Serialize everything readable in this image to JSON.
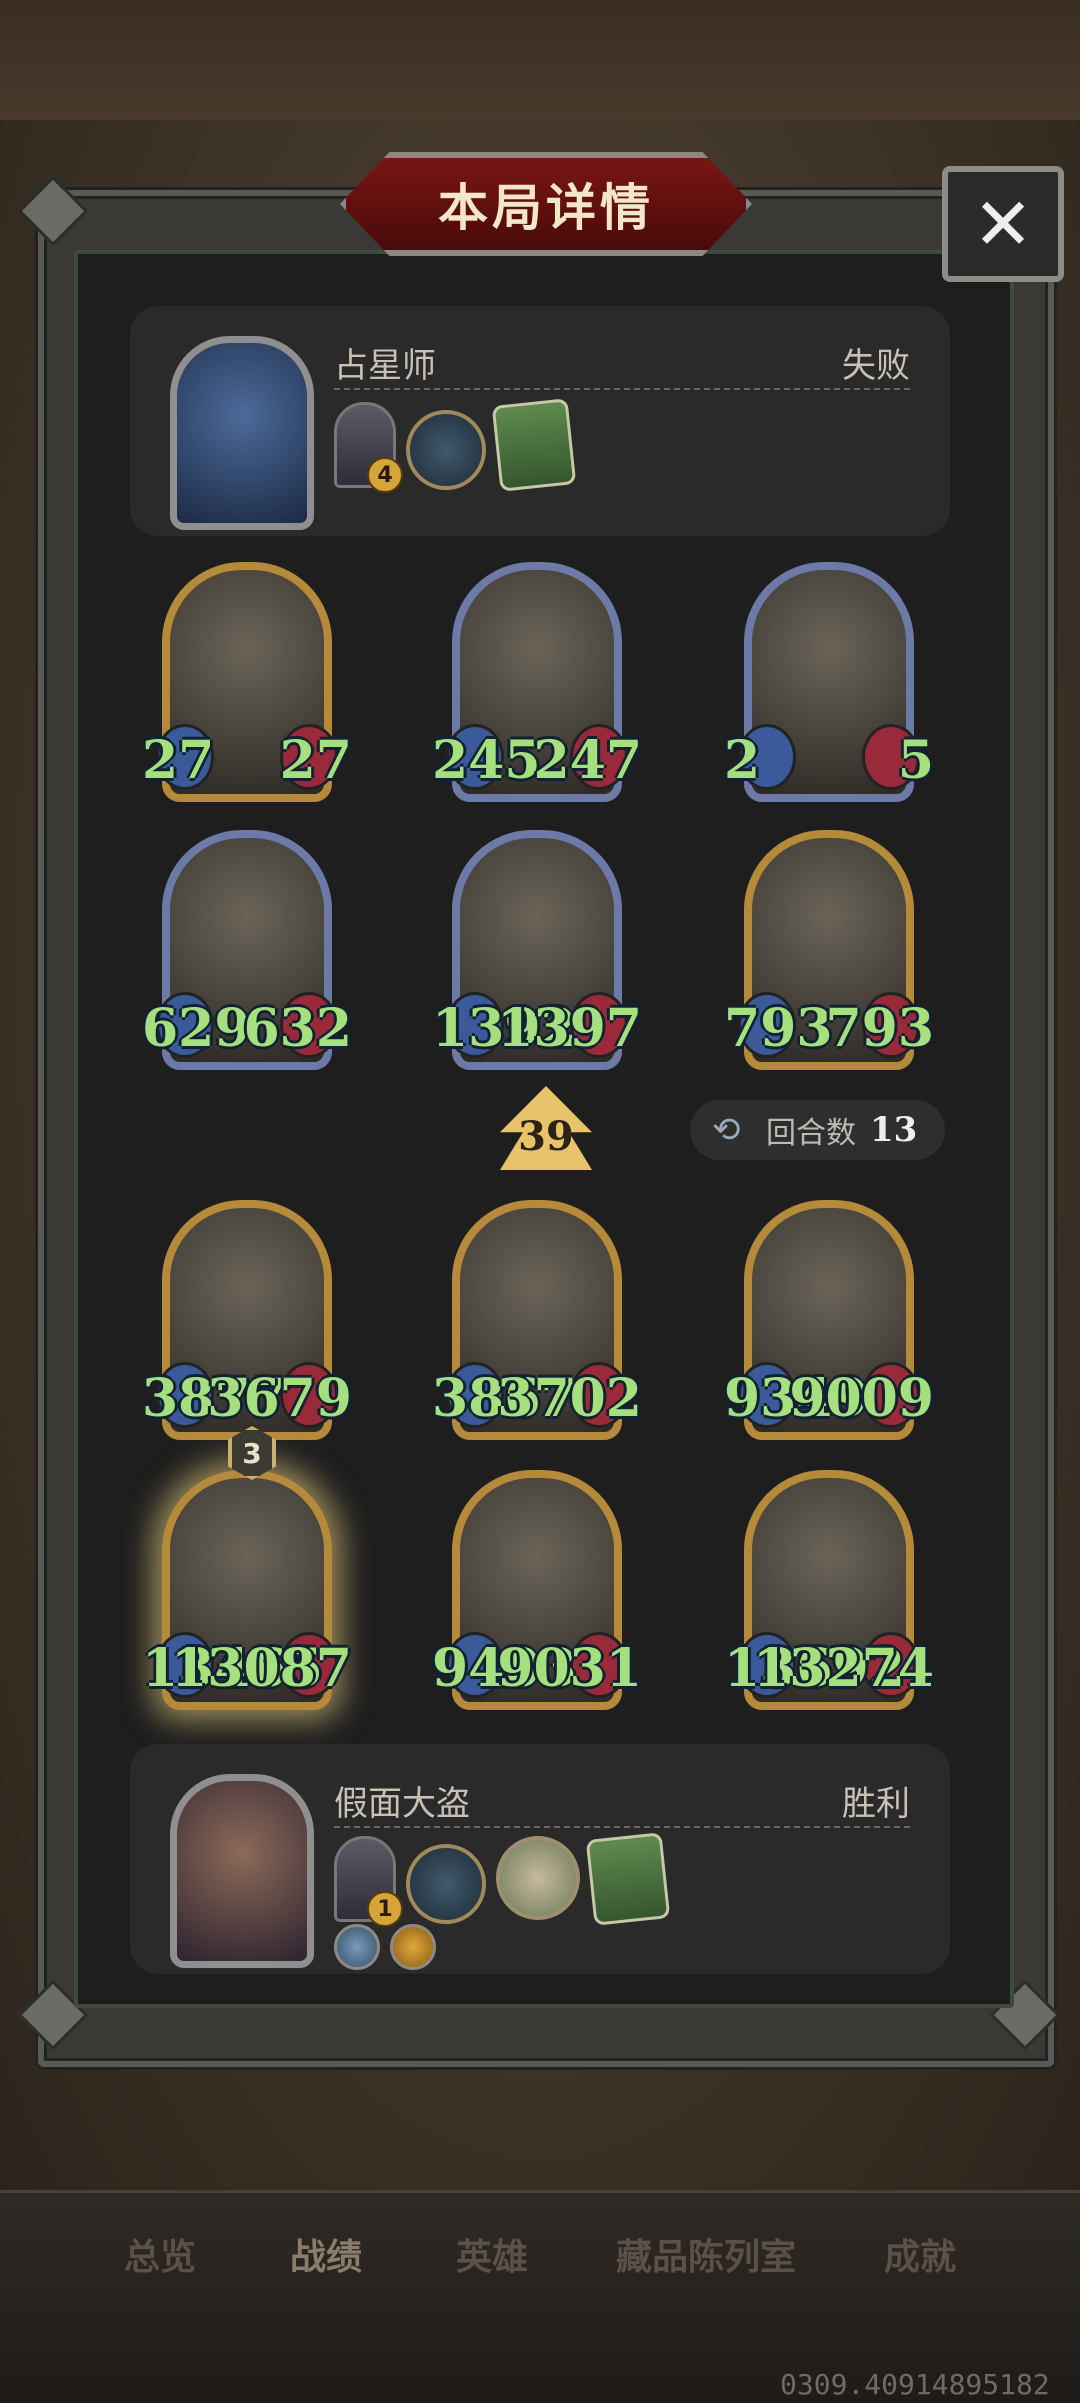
{
  "dialog": {
    "title": "本局详情",
    "close_label": "✕"
  },
  "top_player": {
    "name": "占星师",
    "result": "失败",
    "items": [
      {
        "icon": "door-icon",
        "badge": "4"
      },
      {
        "icon": "pocket-watch-icon",
        "badge": ""
      },
      {
        "icon": "book-icon",
        "badge": ""
      }
    ]
  },
  "bottom_player": {
    "name": "假面大盗",
    "result": "胜利",
    "items": [
      {
        "icon": "mask-door-icon",
        "badge": "1"
      },
      {
        "icon": "pocket-watch-icon",
        "badge": ""
      },
      {
        "icon": "flower-plate-icon",
        "badge": ""
      },
      {
        "icon": "book-icon",
        "badge": ""
      }
    ],
    "skills": [
      {
        "icon": "sword-skill-icon"
      },
      {
        "icon": "gold-skill-icon"
      }
    ]
  },
  "top_board": [
    [
      {
        "atk": "27",
        "hp": "27",
        "frame": "gold"
      },
      {
        "atk": "245",
        "hp": "247",
        "frame": "silver"
      },
      {
        "atk": "2",
        "hp": "5",
        "frame": "silver"
      }
    ],
    [
      {
        "atk": "629",
        "hp": "632",
        "frame": "silver"
      },
      {
        "atk": "1392",
        "hp": "1397",
        "frame": "silver"
      },
      {
        "atk": "793",
        "hp": "793",
        "frame": "gold"
      }
    ]
  ],
  "bottom_board": [
    [
      {
        "atk": "3877",
        "hp": "3679",
        "frame": "gold"
      },
      {
        "atk": "3867",
        "hp": "3702",
        "frame": "gold"
      },
      {
        "atk": "9349",
        "hp": "9009",
        "frame": "gold"
      }
    ],
    [
      {
        "atk": "13465",
        "hp": "13087",
        "frame": "gold",
        "tier": "3"
      },
      {
        "atk": "9403",
        "hp": "9031",
        "frame": "gold"
      },
      {
        "atk": "13692",
        "hp": "13274",
        "frame": "gold"
      }
    ]
  ],
  "level": "39",
  "round": {
    "label": "回合数",
    "value": "13"
  },
  "tabs": [
    "总览",
    "战绩",
    "英雄",
    "藏品陈列室",
    "成就"
  ],
  "active_tab": "战绩",
  "coords_text": "0309.40914895182"
}
